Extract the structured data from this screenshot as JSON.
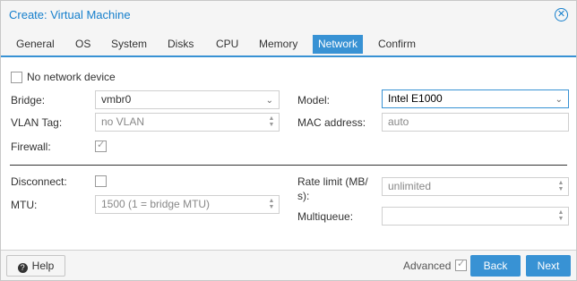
{
  "window": {
    "title": "Create: Virtual Machine"
  },
  "tabs": [
    {
      "label": "General"
    },
    {
      "label": "OS"
    },
    {
      "label": "System"
    },
    {
      "label": "Disks"
    },
    {
      "label": "CPU"
    },
    {
      "label": "Memory"
    },
    {
      "label": "Network"
    },
    {
      "label": "Confirm"
    }
  ],
  "active_tab": "Network",
  "form": {
    "no_network_device": {
      "label": "No network device",
      "checked": false
    },
    "bridge": {
      "label": "Bridge:",
      "value": "vmbr0"
    },
    "vlan_tag": {
      "label": "VLAN Tag:",
      "value": "no VLAN"
    },
    "firewall": {
      "label": "Firewall:",
      "checked": true
    },
    "model": {
      "label": "Model:",
      "value": "Intel E1000"
    },
    "mac_address": {
      "label": "MAC address:",
      "value": "auto"
    },
    "disconnect": {
      "label": "Disconnect:",
      "checked": false
    },
    "mtu": {
      "label": "MTU:",
      "value": "1500 (1 = bridge MTU)"
    },
    "rate_limit": {
      "label_line1": "Rate limit (MB/",
      "label_line2": "s):",
      "value": "unlimited"
    },
    "multiqueue": {
      "label": "Multiqueue:",
      "value": ""
    }
  },
  "footer": {
    "help_label": "Help",
    "advanced_label": "Advanced",
    "advanced_checked": true,
    "back_label": "Back",
    "next_label": "Next"
  },
  "colors": {
    "accent": "#3892d4",
    "title": "#157fcc"
  }
}
